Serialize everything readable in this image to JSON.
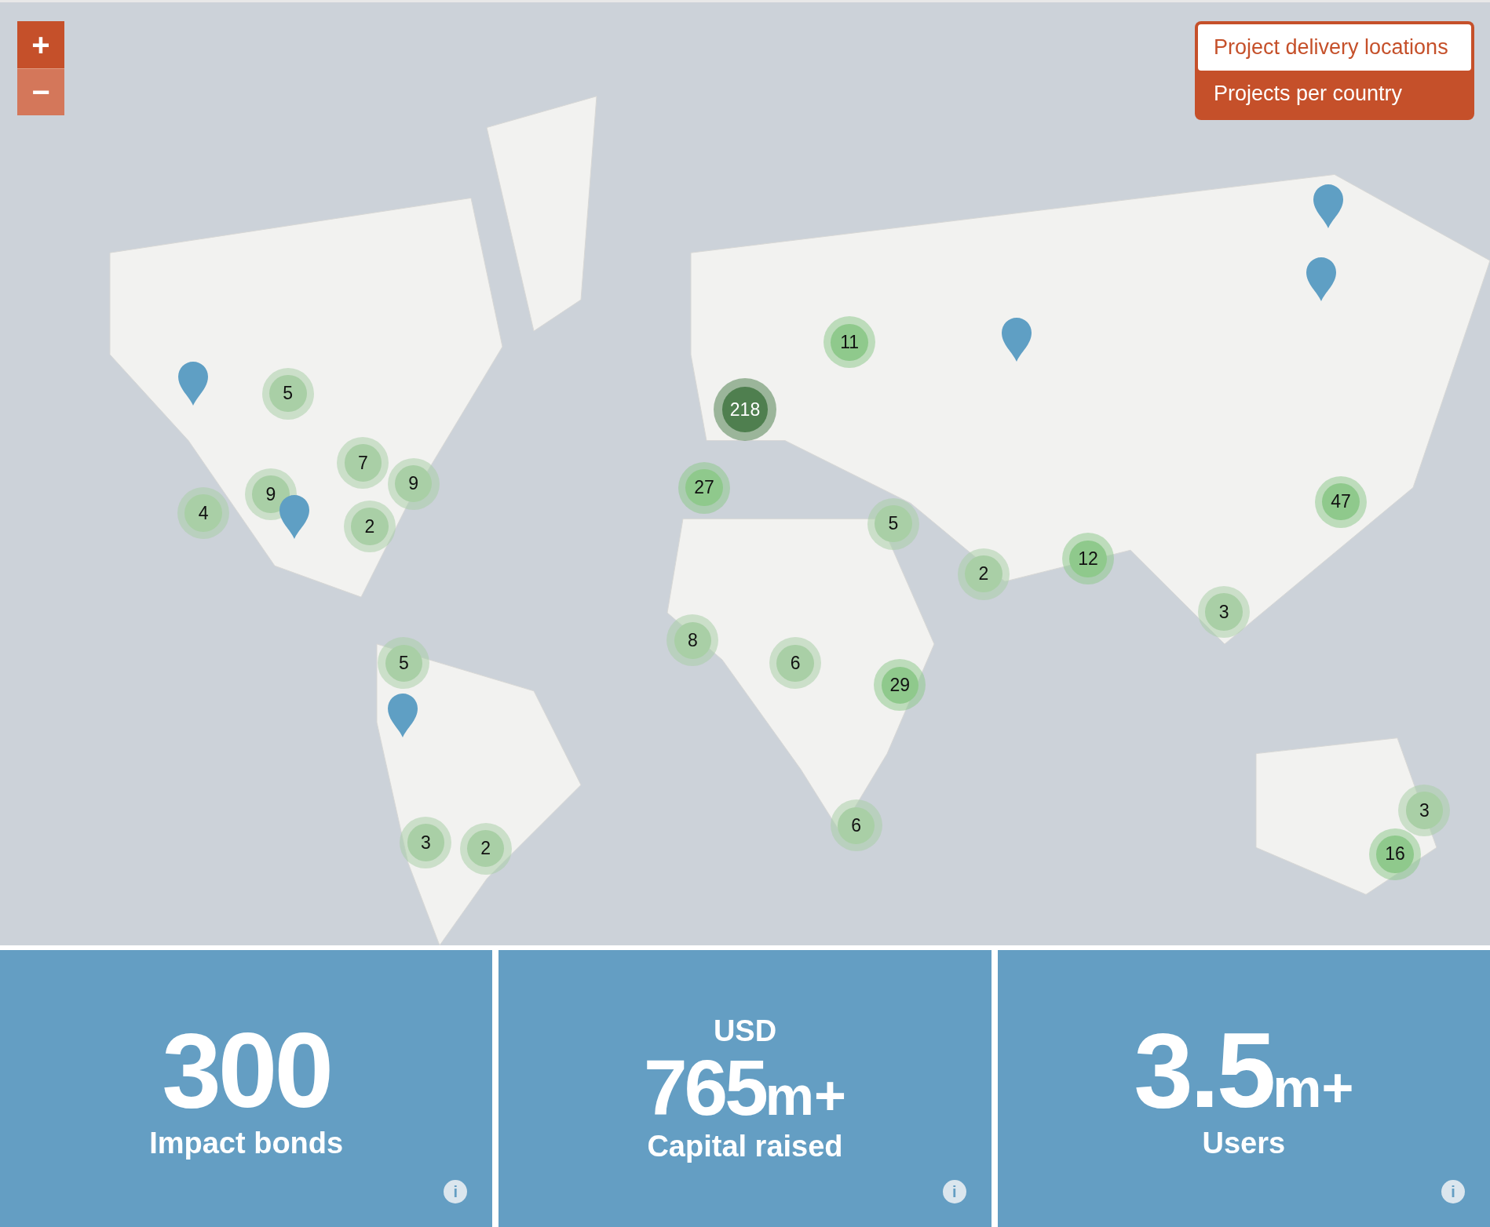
{
  "map": {
    "zoom_controls": [
      {
        "symbol": "+"
      },
      {
        "symbol": "−"
      }
    ],
    "layers": [
      {
        "label": "Project delivery locations",
        "selected": true
      },
      {
        "label": "Projects per country",
        "selected": false
      }
    ],
    "clusters": [
      {
        "count": "5",
        "color": "#a9cfa6"
      },
      {
        "count": "7",
        "color": "#a9cfa6"
      },
      {
        "count": "9",
        "color": "#a9cfa6"
      },
      {
        "count": "9",
        "color": "#a9cfa6"
      },
      {
        "count": "4",
        "color": "#a9cfa6"
      },
      {
        "count": "2",
        "color": "#a9cfa6"
      },
      {
        "count": "5",
        "color": "#a9cfa6"
      },
      {
        "count": "3",
        "color": "#a9cfa6"
      },
      {
        "count": "2",
        "color": "#a9cfa6"
      },
      {
        "count": "218",
        "color": "#4f7f4f"
      },
      {
        "count": "11",
        "color": "#8fc98c"
      },
      {
        "count": "27",
        "color": "#8fc98c"
      },
      {
        "count": "5",
        "color": "#a9cfa6"
      },
      {
        "count": "2",
        "color": "#a9cfa6"
      },
      {
        "count": "12",
        "color": "#8fc98c"
      },
      {
        "count": "8",
        "color": "#a9cfa6"
      },
      {
        "count": "6",
        "color": "#a9cfa6"
      },
      {
        "count": "29",
        "color": "#8fc98c"
      },
      {
        "count": "6",
        "color": "#a9cfa6"
      },
      {
        "count": "47",
        "color": "#8fc98c"
      },
      {
        "count": "3",
        "color": "#a9cfa6"
      },
      {
        "count": "3",
        "color": "#a9cfa6"
      },
      {
        "count": "16",
        "color": "#8fc98c"
      }
    ]
  },
  "stats": [
    {
      "value": "300",
      "label": "Impact bonds",
      "info": "i"
    },
    {
      "prefix": "USD",
      "value": "765",
      "suffix": "m+",
      "label": "Capital raised",
      "info": "i"
    },
    {
      "value": "3.5",
      "suffix": "m+",
      "label": "Users",
      "info": "i"
    }
  ]
}
